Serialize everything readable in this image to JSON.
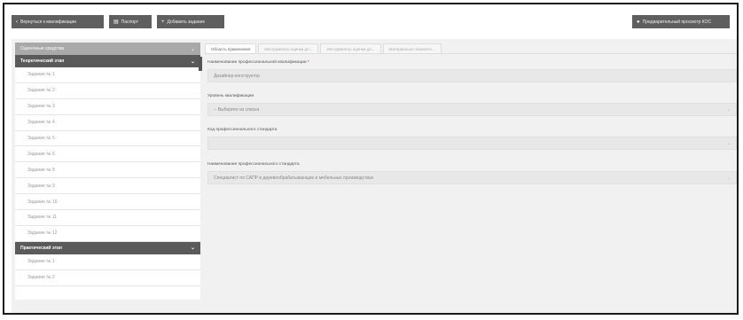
{
  "toolbar": {
    "back_label": "Вернуться к квалификации",
    "passport_label": "Паспорт",
    "add_task_label": "Добавить задание",
    "preview_label": "Предварительный просмотр КОС"
  },
  "sidebar": {
    "header": "Оценочные средства",
    "stages": [
      {
        "title": "Теоретический этап",
        "items": [
          "Задание № 1",
          "Задание № 2",
          "Задание № 3",
          "Задание № 4",
          "Задание № 5",
          "Задание № 6",
          "Задание № 8",
          "Задание № 9",
          "Задание № 10",
          "Задание № 11",
          "Задание № 12"
        ]
      },
      {
        "title": "Практический этап",
        "items": [
          "Задание № 1",
          "Задание № 2"
        ]
      }
    ]
  },
  "tabs": [
    "Область применения",
    "Инструменты оценки дл...",
    "Инструменты оценки дл...",
    "Материально-техничес..."
  ],
  "form": {
    "qual_name_label": "Наименование профессиональной квалификации",
    "required_mark": "*",
    "qual_name_value": "Дизайнер-конструктор",
    "level_label": "Уровень квалификации",
    "level_value": "-- Выберите из списка",
    "std_code_label": "Код профессионального стандарта",
    "std_code_value": "",
    "std_name_label": "Наименование профессионального стандарта",
    "std_name_value": "Специалист по САПР в деревообрабатывающих и мебельных производствах"
  }
}
